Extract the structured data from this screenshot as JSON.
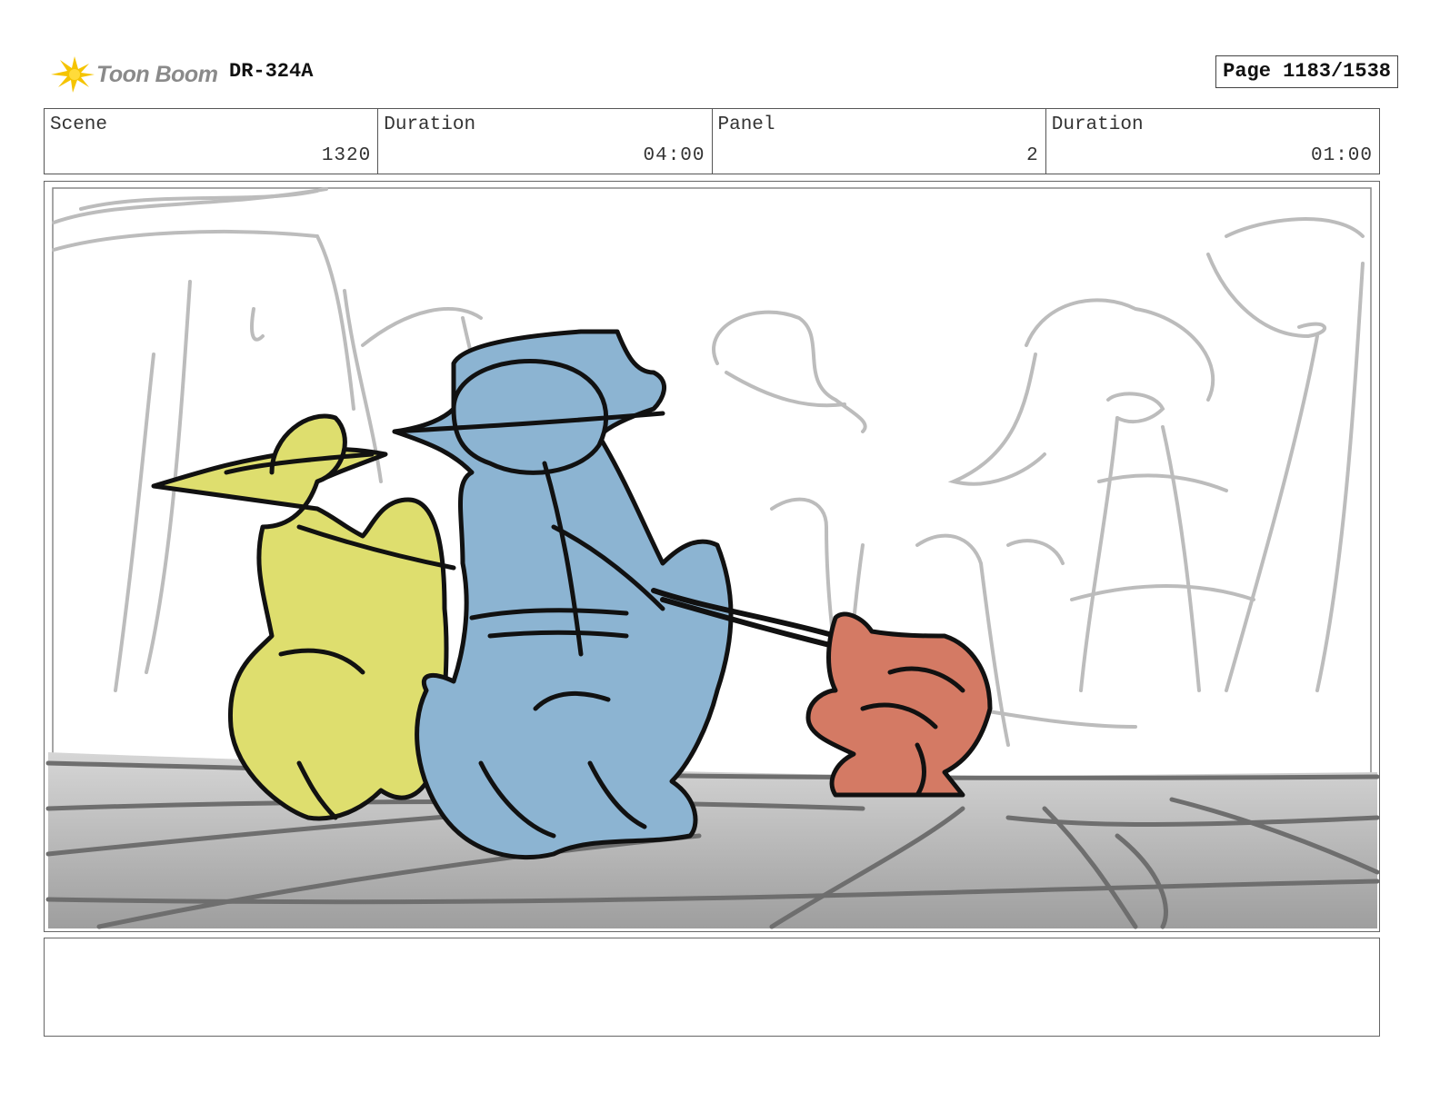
{
  "header": {
    "logo_text": "Toon Boom",
    "doc_id": "DR-324A",
    "page_label": "Page 1183/1538"
  },
  "info": [
    {
      "label": "Scene",
      "value": "1320"
    },
    {
      "label": "Duration",
      "value": "04:00"
    },
    {
      "label": "Panel",
      "value": "2"
    },
    {
      "label": "Duration",
      "value": "01:00"
    }
  ],
  "colors": {
    "yellow_character": "#dede6e",
    "blue_character": "#8cb4d2",
    "red_creature": "#d47a64",
    "logo_yellow": "#f5c400"
  },
  "icons": [
    "toon-boom-logo-icon"
  ],
  "notes": {
    "text": ""
  }
}
